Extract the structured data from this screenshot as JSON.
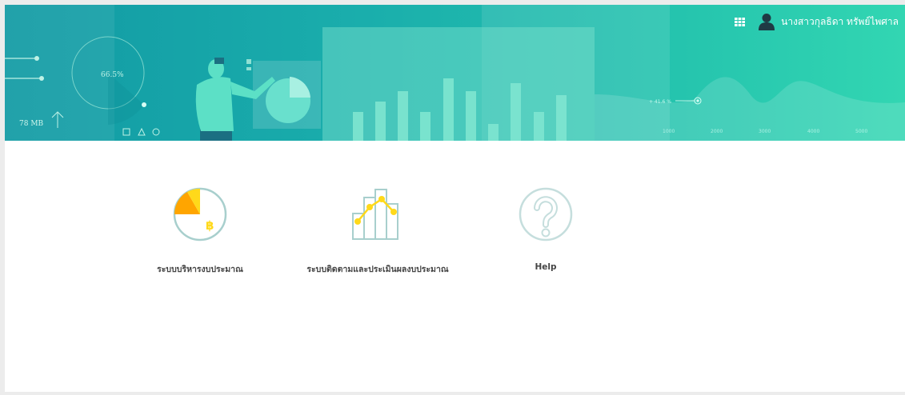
{
  "header": {
    "gauge_value": "66.5%",
    "storage_value": "78 MB",
    "wave_marker": "+ 41.6 %",
    "wave_axis": [
      "1000",
      "2000",
      "3000",
      "4000",
      "5000"
    ],
    "user_name": "นางสาวกุลธิดา ทรัพย์ไพศาล"
  },
  "icons": {
    "apps": "apps-grid-icon",
    "user": "user-avatar-icon"
  },
  "colors": {
    "banner_start": "#129aa4",
    "banner_end": "#32d6b2",
    "accent_yellow": "#ffd91a",
    "accent_orange": "#ffa500",
    "icon_teal": "#a8cfcd"
  },
  "menu": {
    "items": [
      {
        "label": "ระบบบริหารงบประมาณ",
        "icon": "budget-pie-icon"
      },
      {
        "label": "ระบบติดตามและประเมินผลงบประมาณ",
        "icon": "bar-line-chart-icon"
      },
      {
        "label": "Help",
        "icon": "help-question-icon"
      }
    ]
  }
}
